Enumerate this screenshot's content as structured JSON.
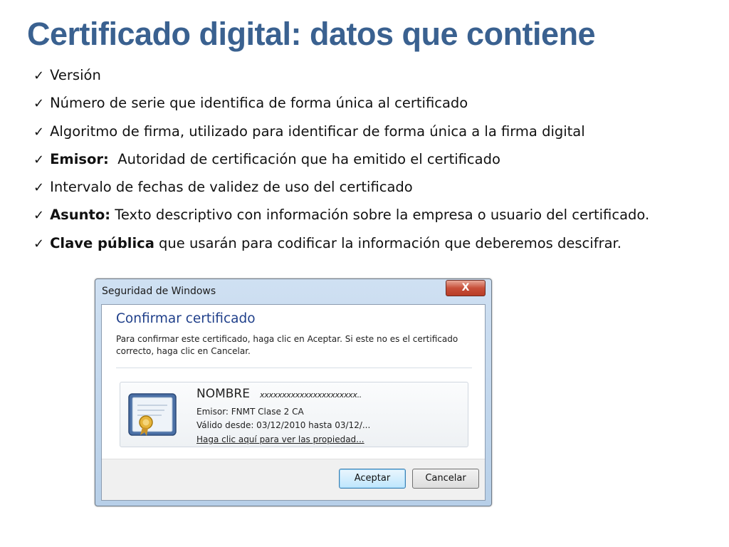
{
  "slide": {
    "title": "Certificado digital: datos que contiene"
  },
  "bullets": [
    {
      "check": "✓",
      "bold": "",
      "text": "Versión"
    },
    {
      "check": "✓",
      "bold": "",
      "text": "Número de serie que identifica de forma única al certificado"
    },
    {
      "check": "✓",
      "bold": "",
      "text": "Algoritmo de firma, utilizado para identificar de forma única a la firma digital"
    },
    {
      "check": "✓",
      "bold": "Emisor:",
      "text": "  Autoridad de certificación que ha emitido el certificado"
    },
    {
      "check": "✓",
      "bold": "",
      "text": "Intervalo de fechas de validez de uso del certificado"
    },
    {
      "check": "✓",
      "bold": "Asunto:",
      "text": " Texto descriptivo con información sobre la empresa o usuario del certificado."
    },
    {
      "check": "✓",
      "bold": "Clave pública",
      "text": " que usarán para codificar la información que deberemos descifrar."
    }
  ],
  "dialog": {
    "title": "Seguridad de Windows",
    "close": "X",
    "heading": "Confirmar certificado",
    "message": "Para confirmar este certificado, haga clic en Aceptar. Si este no es el certificado correcto, haga clic en Cancelar.",
    "certificate": {
      "icon": "certificate-icon",
      "name": "NOMBRE",
      "name_suffix": "xxxxxxxxxxxxxxxxxxxxxx..",
      "issuer": "Emisor: FNMT Clase 2 CA",
      "validity": "Válido desde: 03/12/2010 hasta 03/12/...",
      "properties_link": "Haga clic aquí para ver las propiedad..."
    },
    "buttons": {
      "accept": "Aceptar",
      "cancel": "Cancelar"
    }
  }
}
